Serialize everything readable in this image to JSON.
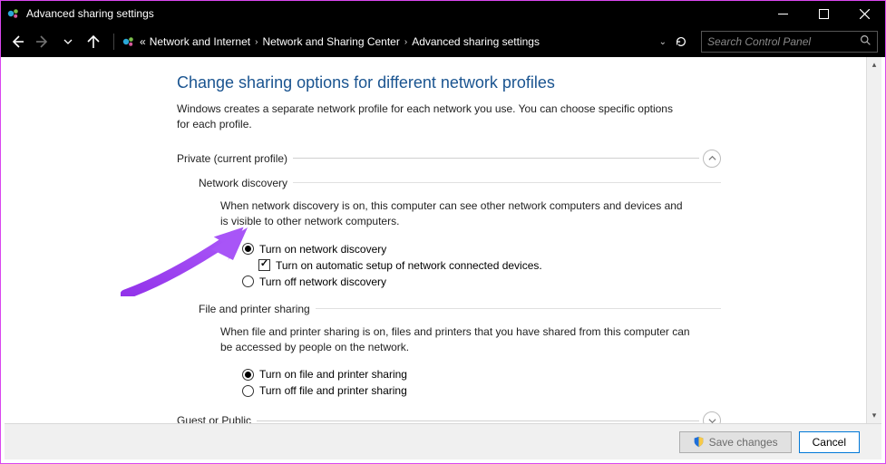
{
  "window": {
    "title": "Advanced sharing settings"
  },
  "breadcrumbs": {
    "pre": "«",
    "items": [
      "Network and Internet",
      "Network and Sharing Center",
      "Advanced sharing settings"
    ]
  },
  "search": {
    "placeholder": "Search Control Panel"
  },
  "page": {
    "title": "Change sharing options for different network profiles",
    "description": "Windows creates a separate network profile for each network you use. You can choose specific options for each profile."
  },
  "sections": {
    "private": {
      "label": "Private (current profile)",
      "network_discovery": {
        "label": "Network discovery",
        "description": "When network discovery is on, this computer can see other network computers and devices and is visible to other network computers.",
        "opt_on": "Turn on network discovery",
        "opt_on_sub": "Turn on automatic setup of network connected devices.",
        "opt_off": "Turn off network discovery"
      },
      "file_printer": {
        "label": "File and printer sharing",
        "description": "When file and printer sharing is on, files and printers that you have shared from this computer can be accessed by people on the network.",
        "opt_on": "Turn on file and printer sharing",
        "opt_off": "Turn off file and printer sharing"
      }
    },
    "guest": {
      "label": "Guest or Public"
    }
  },
  "footer": {
    "save": "Save changes",
    "cancel": "Cancel"
  }
}
